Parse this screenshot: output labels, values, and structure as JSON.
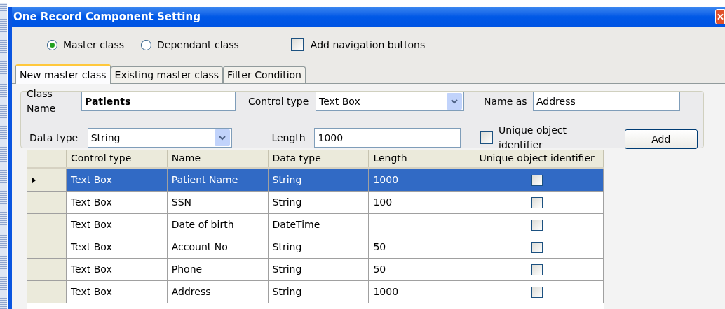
{
  "window": {
    "title": "One Record Component Setting"
  },
  "class_kind": [
    {
      "label": "Master class",
      "selected": true
    },
    {
      "label": "Dependant class",
      "selected": false
    }
  ],
  "navigation_checkbox": {
    "label": "Add navigation buttons",
    "checked": false
  },
  "tabs": [
    {
      "label": "New master class",
      "selected": true
    },
    {
      "label": "Existing master class",
      "selected": false
    },
    {
      "label": "Filter Condition",
      "selected": false
    }
  ],
  "form": {
    "class_name": {
      "label": "Class Name",
      "value": "Patients"
    },
    "control_type": {
      "label": "Control type",
      "value": "Text Box"
    },
    "name_as": {
      "label": "Name as",
      "value": "Address"
    },
    "data_type": {
      "label": "Data type",
      "value": "String"
    },
    "length": {
      "label": "Length",
      "value": "1000"
    },
    "unique": {
      "label": "Unique object identifier",
      "checked": false
    },
    "add_button": "Add"
  },
  "table": {
    "columns": [
      "Control type",
      "Name",
      "Data type",
      "Length",
      "Unique object identifier"
    ],
    "rows": [
      {
        "cells": [
          "Text Box",
          "Patient Name",
          "String",
          "1000"
        ],
        "unique": false,
        "selected": true
      },
      {
        "cells": [
          "Text Box",
          "SSN",
          "String",
          "100"
        ],
        "unique": false,
        "selected": false
      },
      {
        "cells": [
          "Text Box",
          "Date of birth",
          "DateTime",
          ""
        ],
        "unique": false,
        "selected": false
      },
      {
        "cells": [
          "Text Box",
          "Account No",
          "String",
          "50"
        ],
        "unique": false,
        "selected": false
      },
      {
        "cells": [
          "Text Box",
          "Phone",
          "String",
          "50"
        ],
        "unique": false,
        "selected": false
      },
      {
        "cells": [
          "Text Box",
          "Address",
          "String",
          "1000"
        ],
        "unique": false,
        "selected": false
      }
    ]
  }
}
